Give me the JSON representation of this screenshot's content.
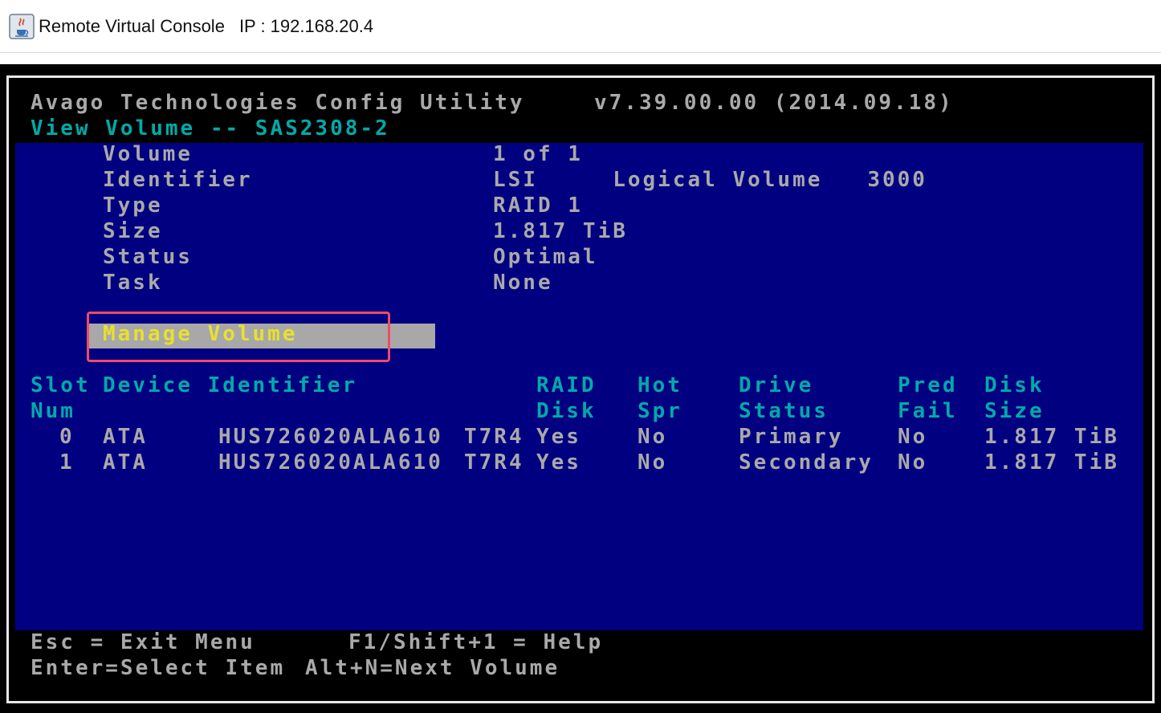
{
  "window": {
    "title": "Remote Virtual Console",
    "ip": "IP : 192.168.20.4",
    "icon": "java-cup-icon"
  },
  "header": {
    "product": "Avago Technologies Config Utility",
    "version": "v7.39.00.00 (2014.09.18)",
    "screen_title": "View Volume -- SAS2308-2"
  },
  "volume": {
    "fields": [
      {
        "label": "Volume",
        "value": "1 of 1"
      },
      {
        "label": "Identifier",
        "value": "LSI     Logical Volume   3000"
      },
      {
        "label": "Type",
        "value": "RAID 1"
      },
      {
        "label": "Size",
        "value": "1.817 TiB"
      },
      {
        "label": "Status",
        "value": "Optimal"
      },
      {
        "label": "Task",
        "value": "None"
      }
    ],
    "manage_label": "Manage Volume"
  },
  "disks": {
    "headers": {
      "slot": [
        "Slot",
        "Num"
      ],
      "device": "Device Identifier",
      "raid": [
        "RAID",
        "Disk"
      ],
      "hot": [
        "Hot",
        "Spr"
      ],
      "drive": [
        "Drive",
        "Status"
      ],
      "pred": [
        "Pred",
        "Fail"
      ],
      "size": [
        "Disk",
        "Size"
      ]
    },
    "rows": [
      {
        "slot": "0",
        "vendor": "ATA",
        "model": "HUS726020ALA610",
        "rev": "T7R4",
        "raid_disk": "Yes",
        "hot_spare": "No",
        "drive_status": "Primary",
        "pred_fail": "No",
        "size": "1.817 TiB"
      },
      {
        "slot": "1",
        "vendor": "ATA",
        "model": "HUS726020ALA610",
        "rev": "T7R4",
        "raid_disk": "Yes",
        "hot_spare": "No",
        "drive_status": "Secondary",
        "pred_fail": "No",
        "size": "1.817 TiB"
      }
    ]
  },
  "footer": {
    "esc": "Esc = Exit Menu",
    "help": "F1/Shift+1 = Help",
    "enter": "Enter=Select Item",
    "next": "Alt+N=Next Volume"
  },
  "colors": {
    "screen_blue": "#000080",
    "text_gray": "#a9a9a9",
    "text_cyan": "#00aaaa",
    "selected_text": "#e8e030",
    "selection_bar": "#a8a8a8",
    "focus_ring": "#ef4a66"
  }
}
